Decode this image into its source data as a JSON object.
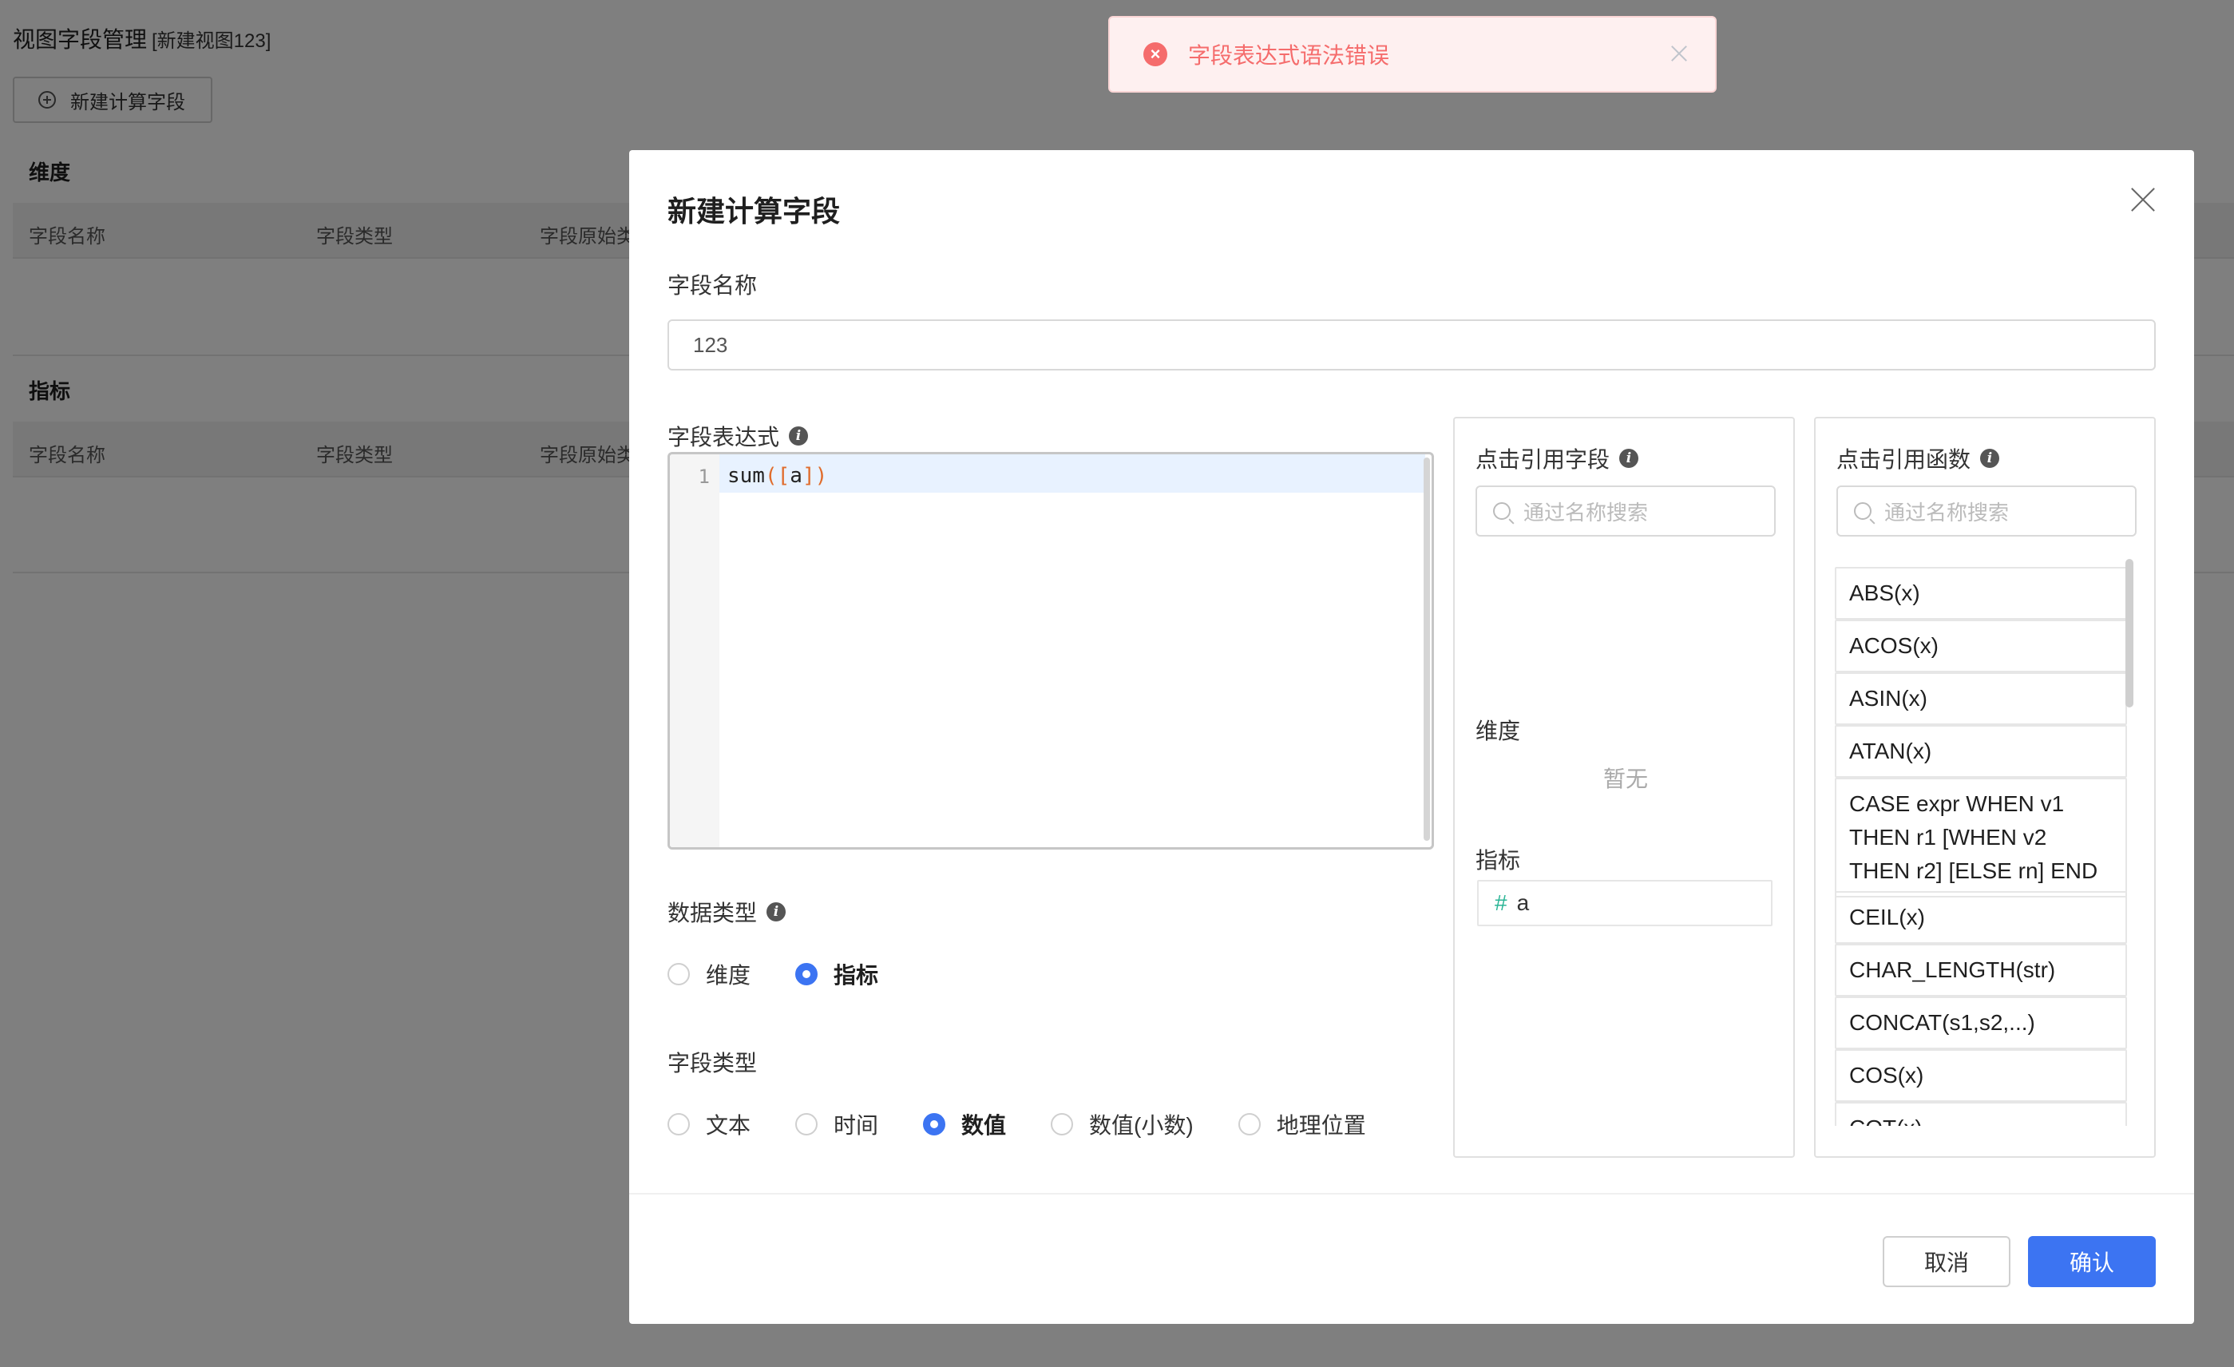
{
  "background": {
    "title": "视图字段管理",
    "subtitle": "[新建视图123]",
    "add_button": "新建计算字段",
    "dimension_section": "维度",
    "metric_section": "指标",
    "columns": [
      "字段名称",
      "字段类型",
      "字段原始类"
    ]
  },
  "toast": {
    "message": "字段表达式语法错误",
    "type": "error"
  },
  "modal": {
    "title": "新建计算字段",
    "field_name_label": "字段名称",
    "field_name_value": "123",
    "expression_label": "字段表达式",
    "expression_line_number": "1",
    "expression_code": {
      "fn": "sum",
      "open": "(",
      "lbracket": "[",
      "arg": "a",
      "rbracket": "]",
      "close": ")"
    },
    "data_type_label": "数据类型",
    "data_type_options": [
      {
        "label": "维度",
        "checked": false
      },
      {
        "label": "指标",
        "checked": true
      }
    ],
    "field_type_label": "字段类型",
    "field_type_options": [
      {
        "label": "文本",
        "checked": false
      },
      {
        "label": "时间",
        "checked": false
      },
      {
        "label": "数值",
        "checked": true
      },
      {
        "label": "数值(小数)",
        "checked": false
      },
      {
        "label": "地理位置",
        "checked": false
      }
    ],
    "ref_fields": {
      "title": "点击引用字段",
      "search_placeholder": "通过名称搜索",
      "dimension_label": "维度",
      "dimension_empty": "暂无",
      "metric_label": "指标",
      "metric_items": [
        {
          "symbol": "#",
          "name": "a"
        }
      ]
    },
    "ref_functions": {
      "title": "点击引用函数",
      "search_placeholder": "通过名称搜索",
      "items": [
        "ABS(x)",
        "ACOS(x)",
        "ASIN(x)",
        "ATAN(x)",
        "CASE expr WHEN v1 THEN r1 [WHEN v2 THEN r2] [ELSE rn] END",
        "CEIL(x)",
        "CHAR_LENGTH(str)",
        "CONCAT(s1,s2,...)",
        "COS(x)",
        "COT(x)"
      ]
    },
    "cancel_label": "取消",
    "confirm_label": "确认",
    "accent_color": "#3c74f2",
    "error_color": "#f56c6c"
  }
}
